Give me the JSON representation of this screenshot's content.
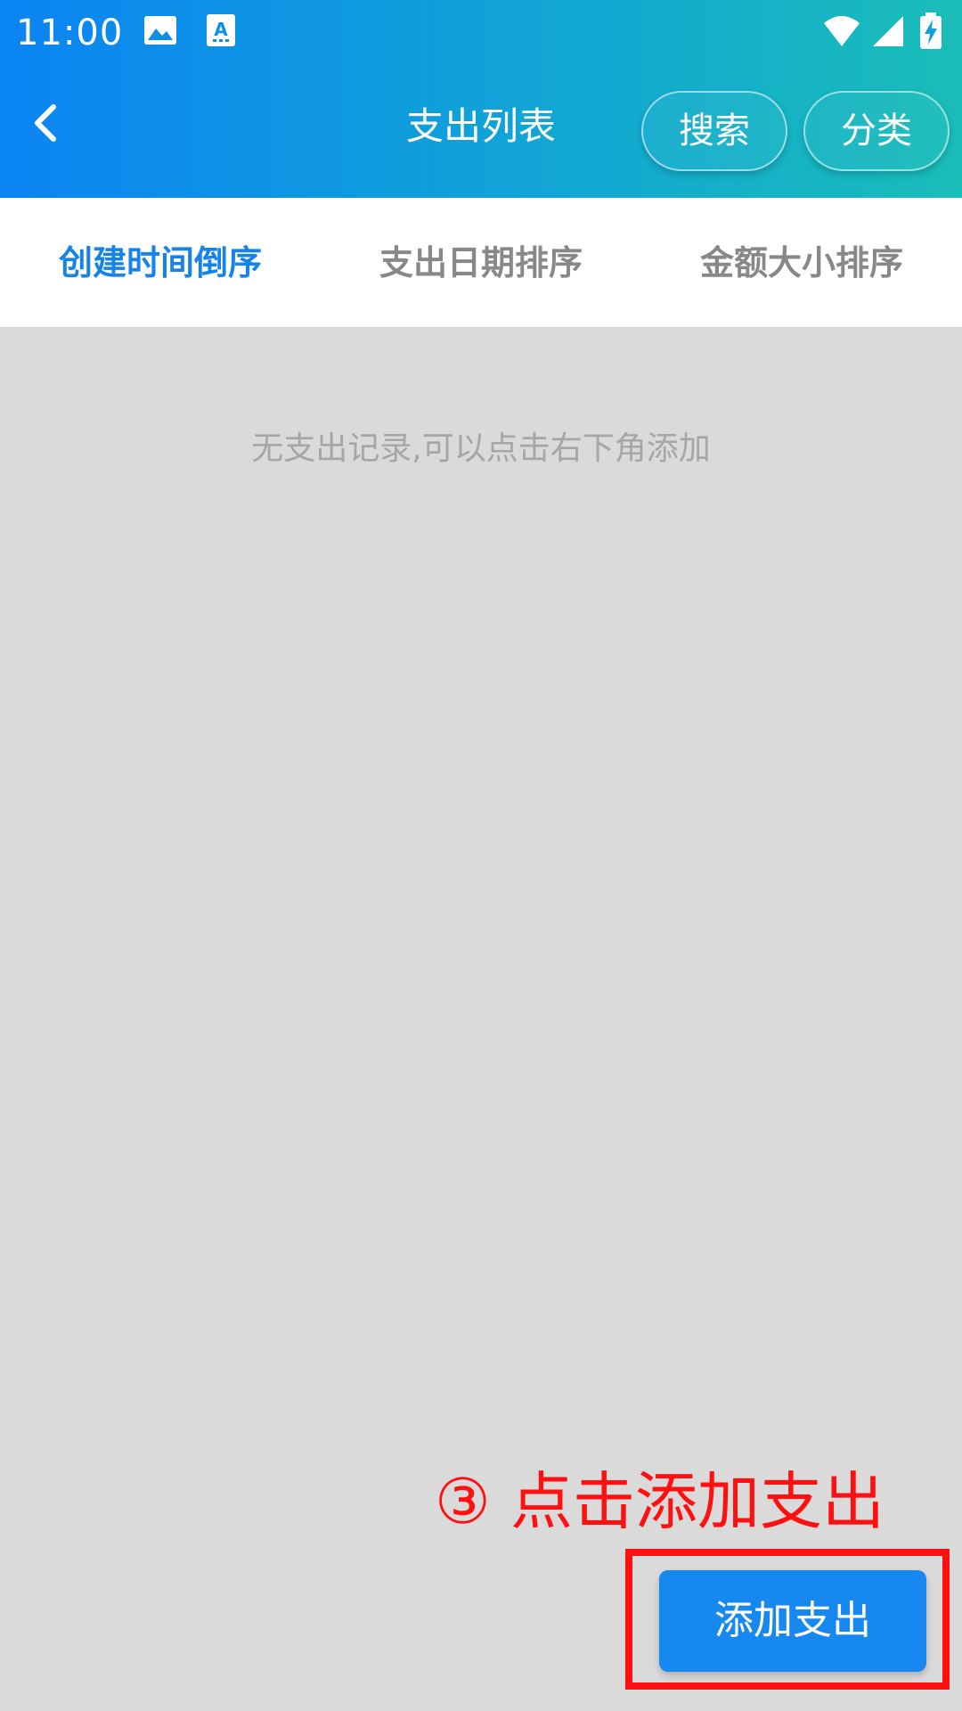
{
  "status_bar": {
    "time": "11:00",
    "left_icons": [
      "image-icon",
      "text-input-icon"
    ],
    "right_icons": [
      "wifi-icon",
      "signal-icon",
      "battery-charging-icon"
    ]
  },
  "app_bar": {
    "title": "支出列表",
    "back_icon": "chevron-left-icon",
    "buttons": [
      {
        "label": "搜索"
      },
      {
        "label": "分类"
      }
    ]
  },
  "sort_tabs": [
    {
      "label": "创建时间倒序",
      "active": true
    },
    {
      "label": "支出日期排序",
      "active": false
    },
    {
      "label": "金额大小排序",
      "active": false
    }
  ],
  "content": {
    "empty_message": "无支出记录,可以点击右下角添加"
  },
  "annotation": {
    "text": "③ 点击添加支出",
    "color": "#ff1010"
  },
  "fab": {
    "label": "添加支出"
  },
  "colors": {
    "header_gradient_start": "#0b84f3",
    "header_gradient_end": "#19bdb8",
    "accent": "#1683e8",
    "button_blue": "#1788f0",
    "background": "#dadada"
  }
}
